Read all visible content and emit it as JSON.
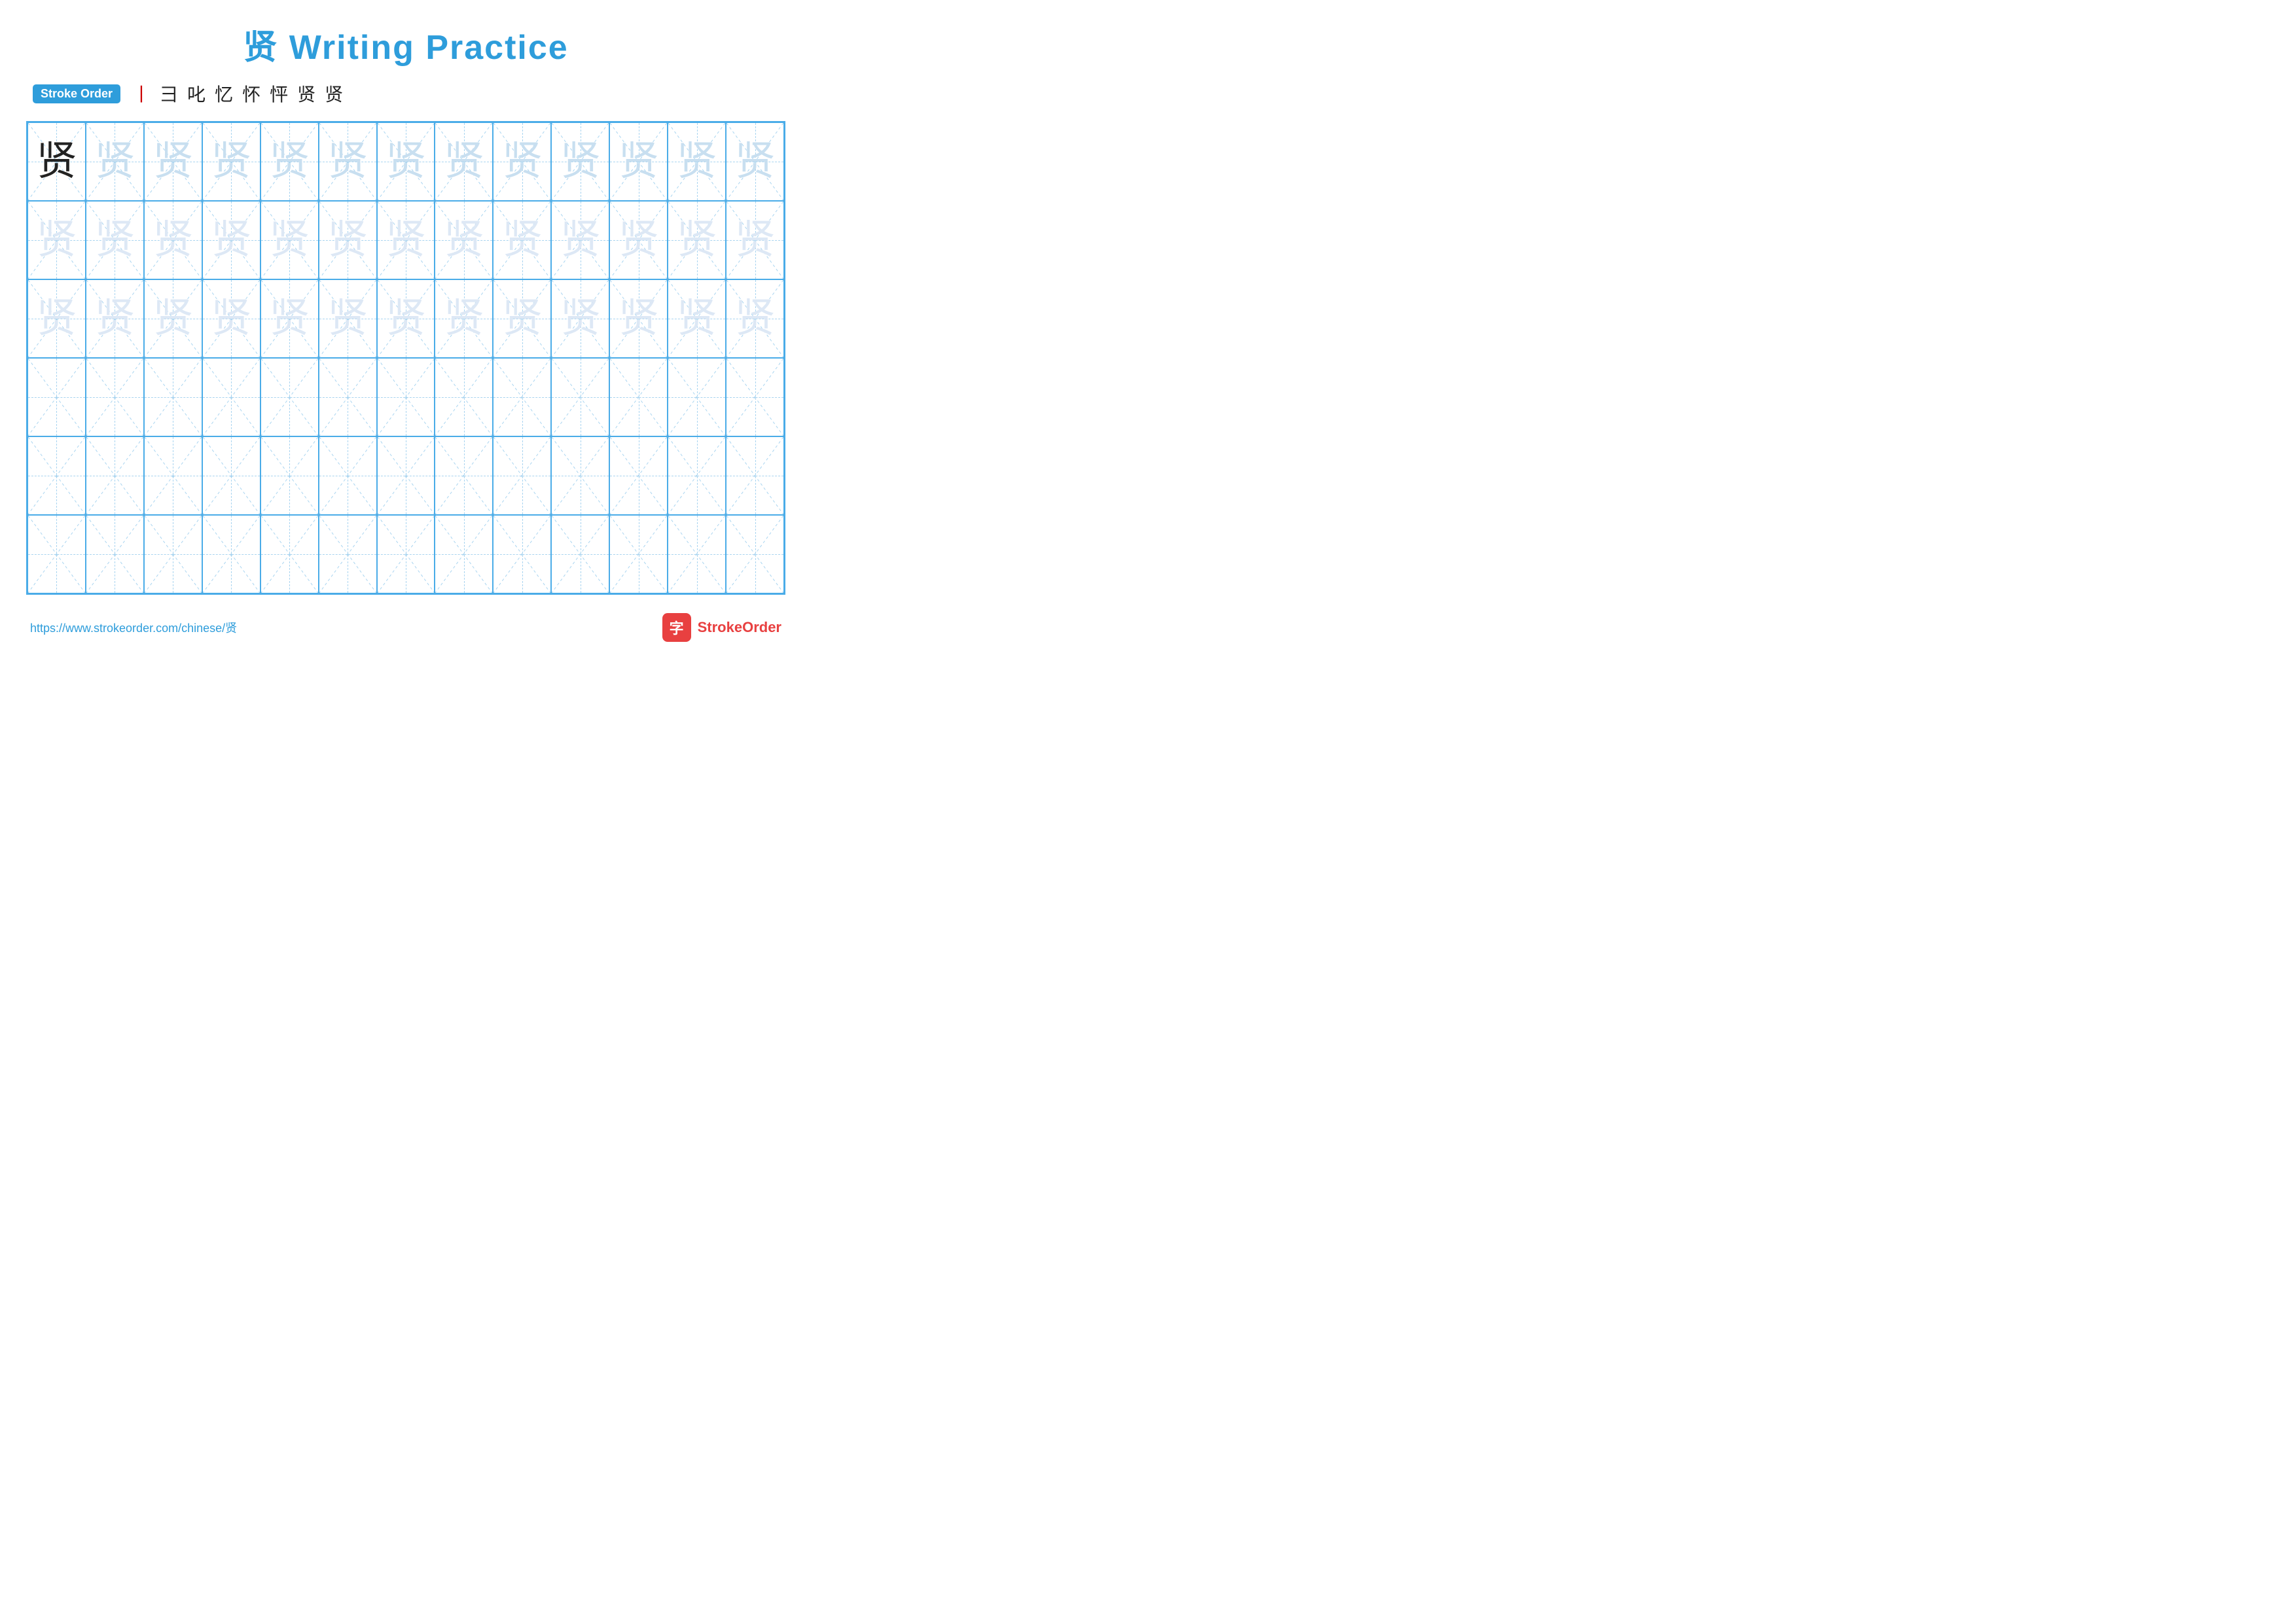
{
  "title": "贤 Writing Practice",
  "stroke_order": {
    "badge": "Stroke Order",
    "steps": [
      "丨",
      "彐",
      "叱",
      "忆",
      "怀",
      "怦",
      "贤",
      "贤"
    ]
  },
  "character": "贤",
  "grid": {
    "rows": 6,
    "cols": 13
  },
  "footer": {
    "url": "https://www.strokeorder.com/chinese/贤",
    "logo_icon": "字",
    "logo_text": "StrokeOrder"
  }
}
